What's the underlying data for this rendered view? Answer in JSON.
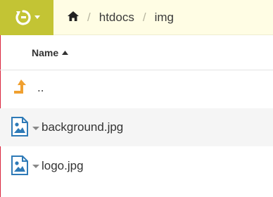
{
  "toolbar": {
    "brand_icon": "restart-icon"
  },
  "breadcrumb": {
    "home_icon": "home-icon",
    "items": [
      "htdocs",
      "img"
    ]
  },
  "list_header": {
    "name_label": "Name",
    "sort": "ascending"
  },
  "rows": [
    {
      "label": "..",
      "icon": "parent-folder-icon"
    },
    {
      "label": "background.jpg",
      "icon": "image-file-icon"
    },
    {
      "label": "logo.jpg",
      "icon": "image-file-icon"
    }
  ],
  "colors": {
    "brand": "#c3c434",
    "breadcrumb_bg": "#fffde4",
    "up_arrow": "#f0a030",
    "file_icon": "#2e7ab7",
    "edge": "#d9263f"
  }
}
